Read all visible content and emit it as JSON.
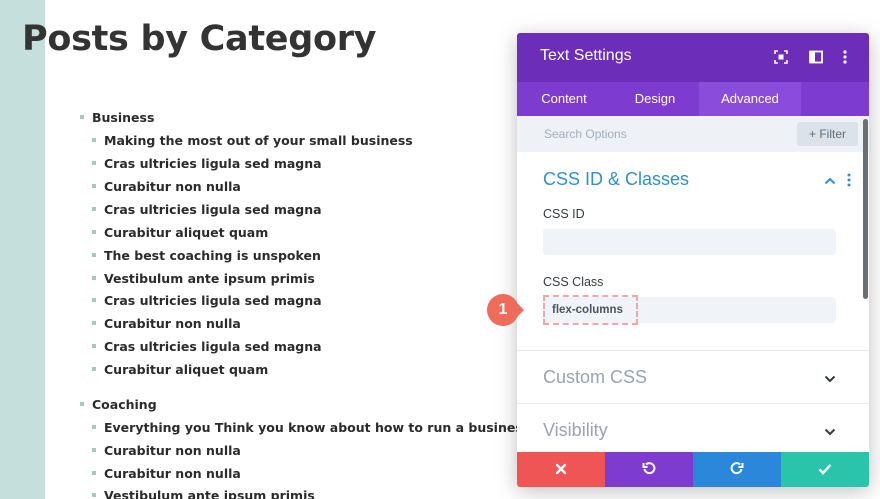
{
  "page": {
    "title": "Posts by Category",
    "categories": [
      {
        "name": "Business",
        "posts": [
          "Making the most out of your small business",
          "Cras ultricies ligula sed magna",
          "Curabitur non nulla",
          "Cras ultricies ligula sed magna",
          "Curabitur aliquet quam",
          "The best coaching is unspoken",
          "Vestibulum ante ipsum primis",
          "Cras ultricies ligula sed magna",
          "Curabitur non nulla",
          "Cras ultricies ligula sed magna",
          "Curabitur aliquet quam"
        ]
      },
      {
        "name": "Coaching",
        "posts": [
          "Everything you Think you know about how to run a business",
          "Curabitur non nulla",
          "Curabitur non nulla",
          "Vestibulum ante ipsum primis"
        ]
      }
    ]
  },
  "settings_modal": {
    "title": "Text Settings",
    "header_icons": [
      "focus-icon",
      "sidebar-toggle-icon",
      "more-vertical-icon"
    ],
    "tabs": [
      {
        "label": "Content",
        "active": false
      },
      {
        "label": "Design",
        "active": false
      },
      {
        "label": "Advanced",
        "active": true
      }
    ],
    "search": {
      "placeholder": "Search Options",
      "filter_label": "+ Filter"
    },
    "section": {
      "title": "CSS ID & Classes",
      "css_id": {
        "label": "CSS ID",
        "value": ""
      },
      "css_class": {
        "label": "CSS Class",
        "value": "flex-columns"
      }
    },
    "collapsed_sections": [
      "Custom CSS",
      "Visibility"
    ],
    "footer": {
      "buttons": [
        {
          "name": "discard",
          "icon": "close-icon",
          "color": "#ef5555"
        },
        {
          "name": "undo",
          "icon": "undo-icon",
          "color": "#7e3bd0"
        },
        {
          "name": "redo",
          "icon": "redo-icon",
          "color": "#2b87da"
        },
        {
          "name": "save",
          "icon": "check-icon",
          "color": "#29c4a9"
        }
      ]
    }
  },
  "callout": {
    "number": "1",
    "color": "#ef6c5a"
  },
  "colors": {
    "header": "#6c2eb9",
    "tabs": "#7d3bcf",
    "section_title": "#2e8fd6",
    "left_strip": "#c5e0dc"
  }
}
